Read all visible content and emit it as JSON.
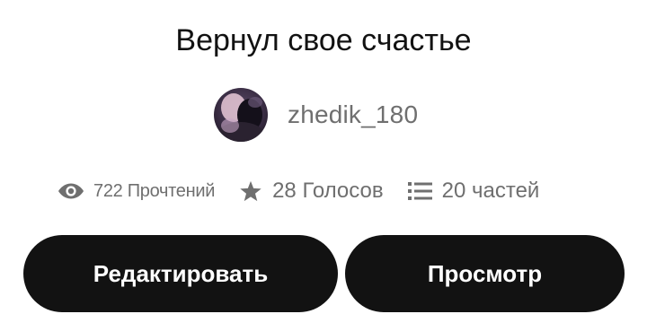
{
  "story": {
    "title": "Вернул свое счастье"
  },
  "author": {
    "username": "zhedik_180"
  },
  "stats": {
    "reads": {
      "icon": "eye-icon",
      "label": "722 Прочтений"
    },
    "votes": {
      "icon": "star-icon",
      "label": "28 Голосов"
    },
    "parts": {
      "icon": "list-icon",
      "label": "20 частей"
    }
  },
  "actions": {
    "edit_label": "Редактировать",
    "view_label": "Просмотр"
  },
  "colors": {
    "text_primary": "#121212",
    "text_secondary": "#6f6f6f",
    "button_bg": "#121212",
    "button_text": "#ffffff",
    "background": "#ffffff"
  }
}
